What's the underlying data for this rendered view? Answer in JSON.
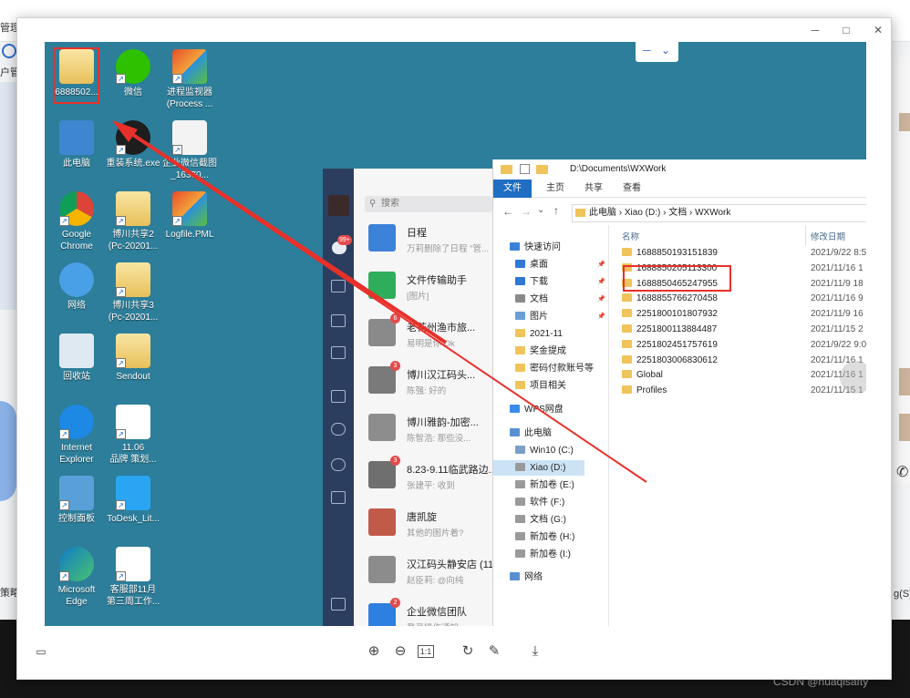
{
  "background": {
    "top_left_1": "管理",
    "top_left_2": "户管",
    "left_mid": "策略",
    "right_tail": "g(S)",
    "watermark": "CSDN @huaqisafty"
  },
  "viewer": {
    "controls": [
      "─",
      "□",
      "✕"
    ],
    "toolbar": {
      "zoom_in": "zoom-in",
      "zoom_out": "zoom-out",
      "actual": "1:1",
      "rotate": "rotate",
      "edit": "edit",
      "download": "download"
    }
  },
  "desktop": {
    "icons": [
      {
        "label": "6888502...",
        "kind": "folder"
      },
      {
        "label": "微信",
        "kind": "wechat"
      },
      {
        "label": "进程监视器\n(Process ...",
        "kind": "window"
      },
      {
        "label": "此电脑",
        "kind": "pc"
      },
      {
        "label": "重装系统.exe",
        "kind": "exe"
      },
      {
        "label": "企业微信截图\n_16370...",
        "kind": "shield"
      },
      {
        "label": "Google\nChrome",
        "kind": "chrome"
      },
      {
        "label": "博川共享2\n(Pc-20201...",
        "kind": "share"
      },
      {
        "label": "Logfile.PML",
        "kind": "window"
      },
      {
        "label": "网络",
        "kind": "network"
      },
      {
        "label": "博川共享3\n(Pc-20201...",
        "kind": "share"
      },
      {
        "label": "回收站",
        "kind": "recycle"
      },
      {
        "label": "Sendout",
        "kind": "folder"
      },
      {
        "label": "Internet\nExplorer",
        "kind": "ie"
      },
      {
        "label": "11.06\n品牌 策划...",
        "kind": "word"
      },
      {
        "label": "控制面板",
        "kind": "control"
      },
      {
        "label": "ToDesk_Lit...",
        "kind": "todesk"
      },
      {
        "label": "Microsoft\nEdge",
        "kind": "edge"
      },
      {
        "label": "客服部11月\n第三周工作...",
        "kind": "sheet"
      }
    ],
    "dropdown": {
      "minus": "─",
      "chev": "⌄"
    }
  },
  "wecom": {
    "search": "搜索",
    "badge_side": "99+",
    "chats": [
      {
        "name": "日程",
        "preview": "万莉删除了日程 \"管...",
        "color": "#3b82d8",
        "badge": ""
      },
      {
        "name": "文件传输助手",
        "preview": "[图片]",
        "color": "#2eae5a",
        "badge": ""
      },
      {
        "name": "老花州渔市旅...",
        "preview": "易明是你 Ok",
        "color": "#8a8a8a",
        "badge": "6"
      },
      {
        "name": "博川汉江码头...",
        "preview": "陈强: 好的",
        "color": "#7a7a7a",
        "badge": "3"
      },
      {
        "name": "博川雅韵-加密...",
        "preview": "陈智浩: 那些没...",
        "color": "#8d8d8d",
        "badge": ""
      },
      {
        "name": "8.23-9.11临武路边...",
        "preview": "张建平: 收到",
        "color": "#6f6f6f",
        "badge": "3"
      },
      {
        "name": "唐凯旋",
        "preview": "其他的图片着?",
        "color": "#c25a4a",
        "badge": ""
      },
      {
        "name": "汉江码头静安店 (11",
        "preview": "赵臣莉: @向纯",
        "color": "#8c8c8c",
        "badge": ""
      },
      {
        "name": "企业微信团队",
        "preview": "登录操作通知",
        "color": "#2d7fe0",
        "badge": "2"
      }
    ]
  },
  "explorer": {
    "title": "D:\\Documents\\WXWork",
    "ribbon": [
      "文件",
      "主页",
      "共享",
      "查看"
    ],
    "crumbs": "此电脑 › Xiao (D:) › 文档 › WXWork",
    "nav": [
      {
        "label": "快速访问",
        "lvl": 0,
        "ic": "#3b82d8"
      },
      {
        "label": "桌面",
        "lvl": 1,
        "ic": "#2e78d6"
      },
      {
        "label": "下载",
        "lvl": 1,
        "ic": "#2e78d6"
      },
      {
        "label": "文档",
        "lvl": 1,
        "ic": "#8a8a8a"
      },
      {
        "label": "图片",
        "lvl": 1,
        "ic": "#6aa0d6"
      },
      {
        "label": "2021-11",
        "lvl": 1,
        "ic": "#f0c45b"
      },
      {
        "label": "奖金提成",
        "lvl": 1,
        "ic": "#f0c45b"
      },
      {
        "label": "密码付款账号等",
        "lvl": 1,
        "ic": "#f0c45b"
      },
      {
        "label": "项目相关",
        "lvl": 1,
        "ic": "#f0c45b"
      },
      {
        "label": "WPS网盘",
        "lvl": 0,
        "ic": "#3b8be8"
      },
      {
        "label": "此电脑",
        "lvl": 0,
        "ic": "#5a8ed0"
      },
      {
        "label": "Win10 (C:)",
        "lvl": 1,
        "ic": "#7a9fc8"
      },
      {
        "label": "Xiao (D:)",
        "lvl": 1,
        "ic": "#9a9a9a"
      },
      {
        "label": "新加卷 (E:)",
        "lvl": 1,
        "ic": "#9a9a9a"
      },
      {
        "label": "软件 (F:)",
        "lvl": 1,
        "ic": "#9a9a9a"
      },
      {
        "label": "文档 (G:)",
        "lvl": 1,
        "ic": "#9a9a9a"
      },
      {
        "label": "新加卷 (H:)",
        "lvl": 1,
        "ic": "#9a9a9a"
      },
      {
        "label": "新加卷 (I:)",
        "lvl": 1,
        "ic": "#9a9a9a"
      },
      {
        "label": "网络",
        "lvl": 0,
        "ic": "#5a8ed0"
      }
    ],
    "col_name": "名称",
    "col_date": "修改日期",
    "files": [
      {
        "name": "1688850193151839",
        "date": "2021/9/22 8:5"
      },
      {
        "name": "1688850205113300",
        "date": "2021/11/16 1"
      },
      {
        "name": "1688850465247955",
        "date": "2021/11/9 18"
      },
      {
        "name": "1688855766270458",
        "date": "2021/11/16 9"
      },
      {
        "name": "2251800101807932",
        "date": "2021/11/9 16"
      },
      {
        "name": "2251800113884487",
        "date": "2021/11/15 2"
      },
      {
        "name": "2251802451757619",
        "date": "2021/9/22 9:0"
      },
      {
        "name": "2251803006830612",
        "date": "2021/11/16 1"
      },
      {
        "name": "Global",
        "date": "2021/11/16 1"
      },
      {
        "name": "Profiles",
        "date": "2021/11/15 1"
      }
    ]
  },
  "colors": {
    "desktop": "#2c7e9a",
    "wecom_side": "#2c3e60",
    "annotation": "#e8302a",
    "ribbon_file": "#1f6ec2"
  }
}
